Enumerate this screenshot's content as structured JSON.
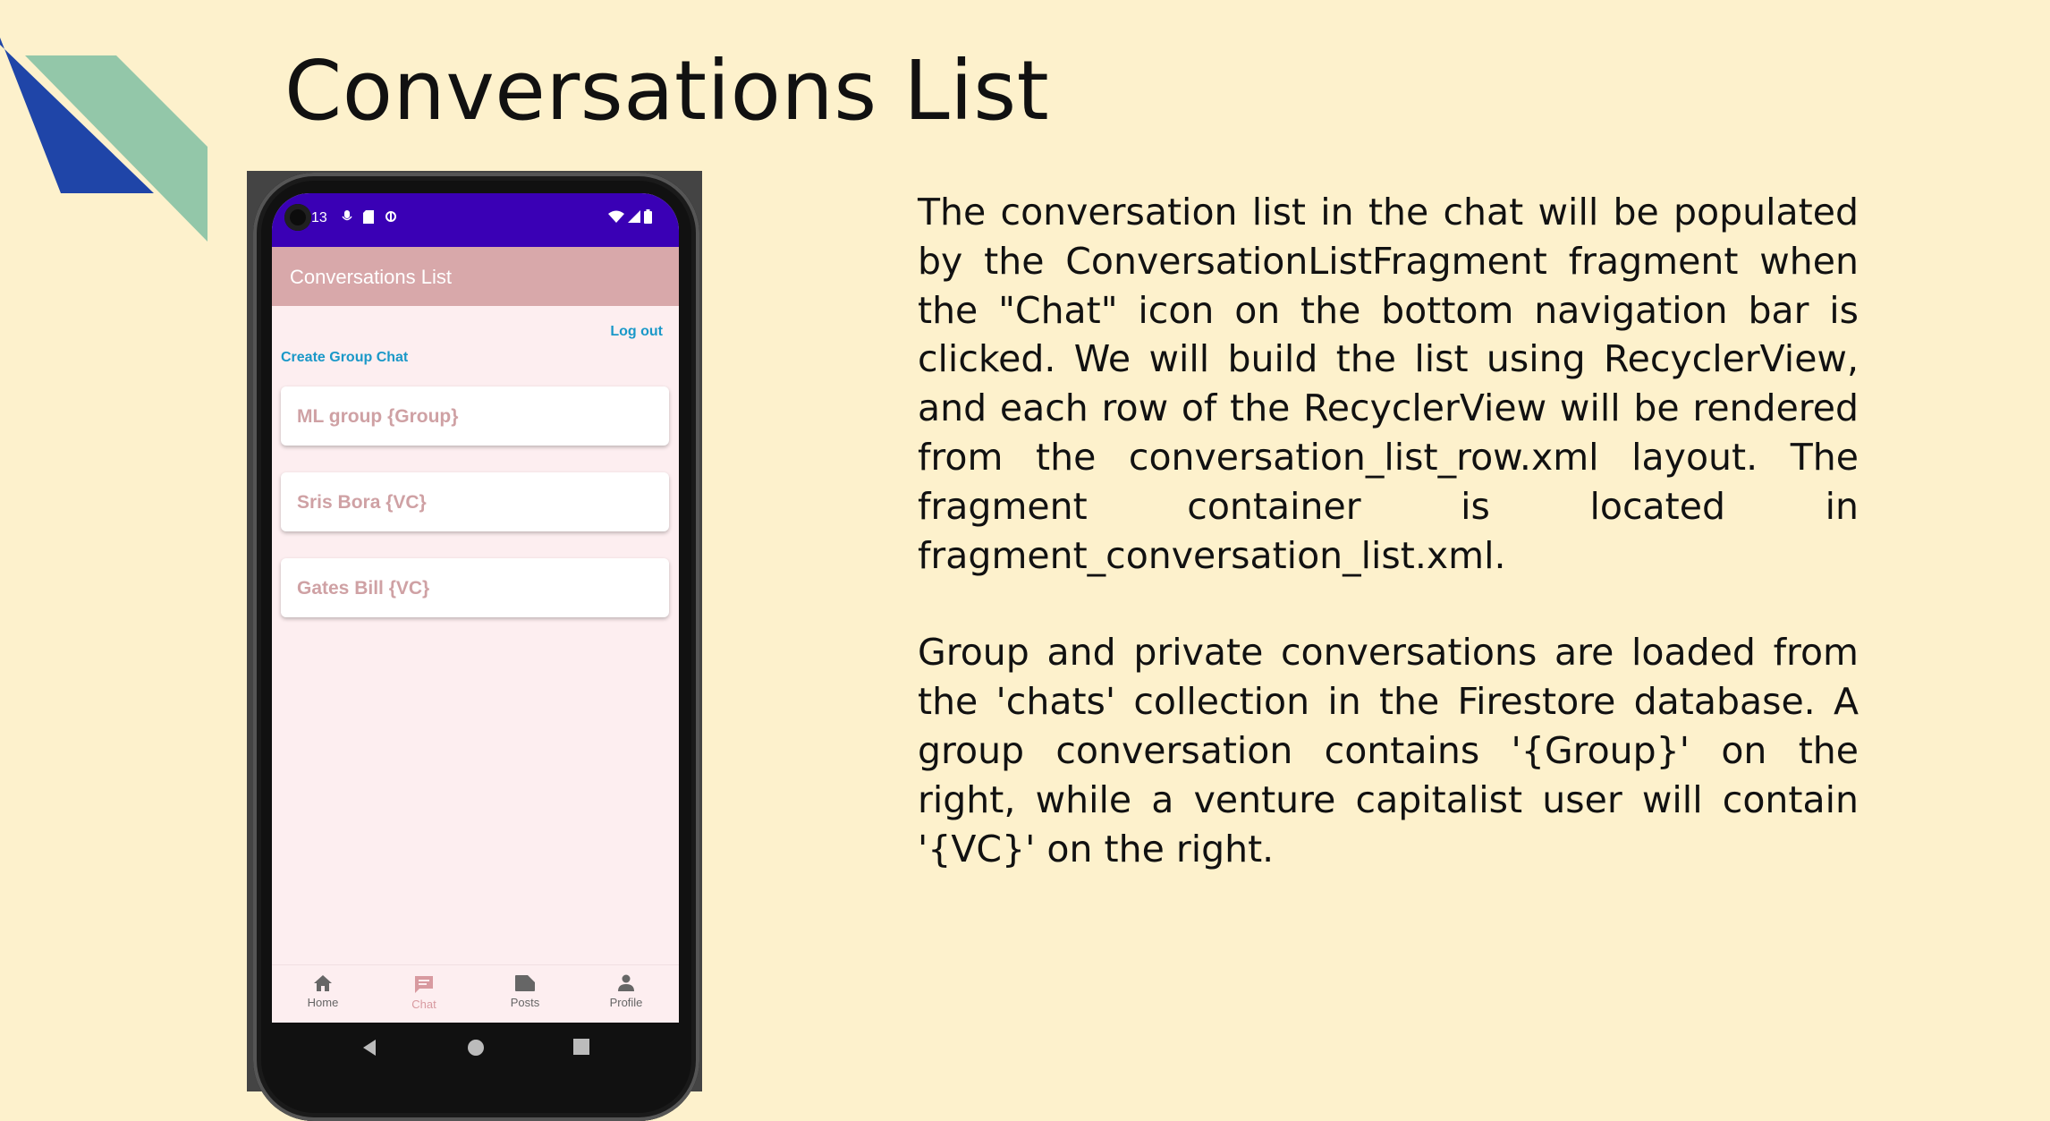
{
  "slide": {
    "title": "Conversations List",
    "paragraphs": [
      "The conversation list in the chat will be populated by the ConversationListFragment fragment when the \"Chat\" icon on the bottom navigation bar is clicked. We will build the list using RecyclerView, and each row of the RecyclerView will be rendered from the conversation_list_row.xml layout. The fragment container is located in fragment_conversation_list.xml.",
      "Group and private conversations are loaded from the 'chats' collection in the Firestore database. A group conversation contains '{Group}' on the right, while a venture capitalist user will contain '{VC}' on the right."
    ]
  },
  "phone": {
    "status_bar": {
      "time": "13",
      "icons_left": [
        "mic-icon",
        "sd-card-icon",
        "sync-icon"
      ],
      "icons_right": [
        "wifi-icon",
        "signal-icon",
        "battery-icon"
      ]
    },
    "app_bar": {
      "title": "Conversations List"
    },
    "actions": {
      "logout": "Log out",
      "create_group": "Create Group Chat"
    },
    "conversations": [
      {
        "label": "ML group {Group}"
      },
      {
        "label": "Sris Bora {VC}"
      },
      {
        "label": "Gates Bill {VC}"
      }
    ],
    "bottom_nav": [
      {
        "label": "Home",
        "icon": "home-icon",
        "active": false
      },
      {
        "label": "Chat",
        "icon": "chat-icon",
        "active": true
      },
      {
        "label": "Posts",
        "icon": "posts-icon",
        "active": false
      },
      {
        "label": "Profile",
        "icon": "profile-icon",
        "active": false
      }
    ]
  },
  "colors": {
    "background": "#fdf1cc",
    "status_bar": "#3a00b5",
    "app_bar": "#d8a8aa",
    "link": "#1a98c8",
    "row_text": "#cfa1a4",
    "nav_active": "#d89aa0",
    "deco_blue": "#1f45a8",
    "deco_green": "#93c7a9"
  }
}
